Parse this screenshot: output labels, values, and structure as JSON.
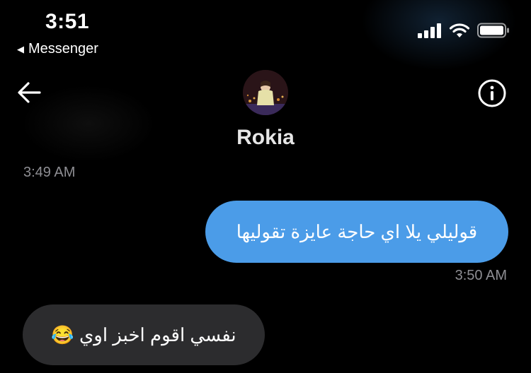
{
  "status_bar": {
    "time": "3:51",
    "back_app_label": "Messenger"
  },
  "header": {
    "contact_name": "Rokia"
  },
  "messages": [
    {
      "timestamp": "3:49 AM"
    },
    {
      "direction": "outgoing",
      "text": "قوليلي يلا اي حاجة عايزة تقوليها",
      "timestamp": "3:50 AM"
    },
    {
      "direction": "incoming",
      "text": "نفسي اقوم اخبز اوي 😂"
    }
  ],
  "colors": {
    "background": "#000000",
    "outgoing_bubble": "#4b9ce8",
    "incoming_bubble": "#2c2c2e",
    "timestamp": "#8e8e93"
  },
  "icons": [
    "back-triangle-icon",
    "signal-icon",
    "wifi-icon",
    "battery-icon",
    "back-arrow-icon",
    "info-icon"
  ]
}
